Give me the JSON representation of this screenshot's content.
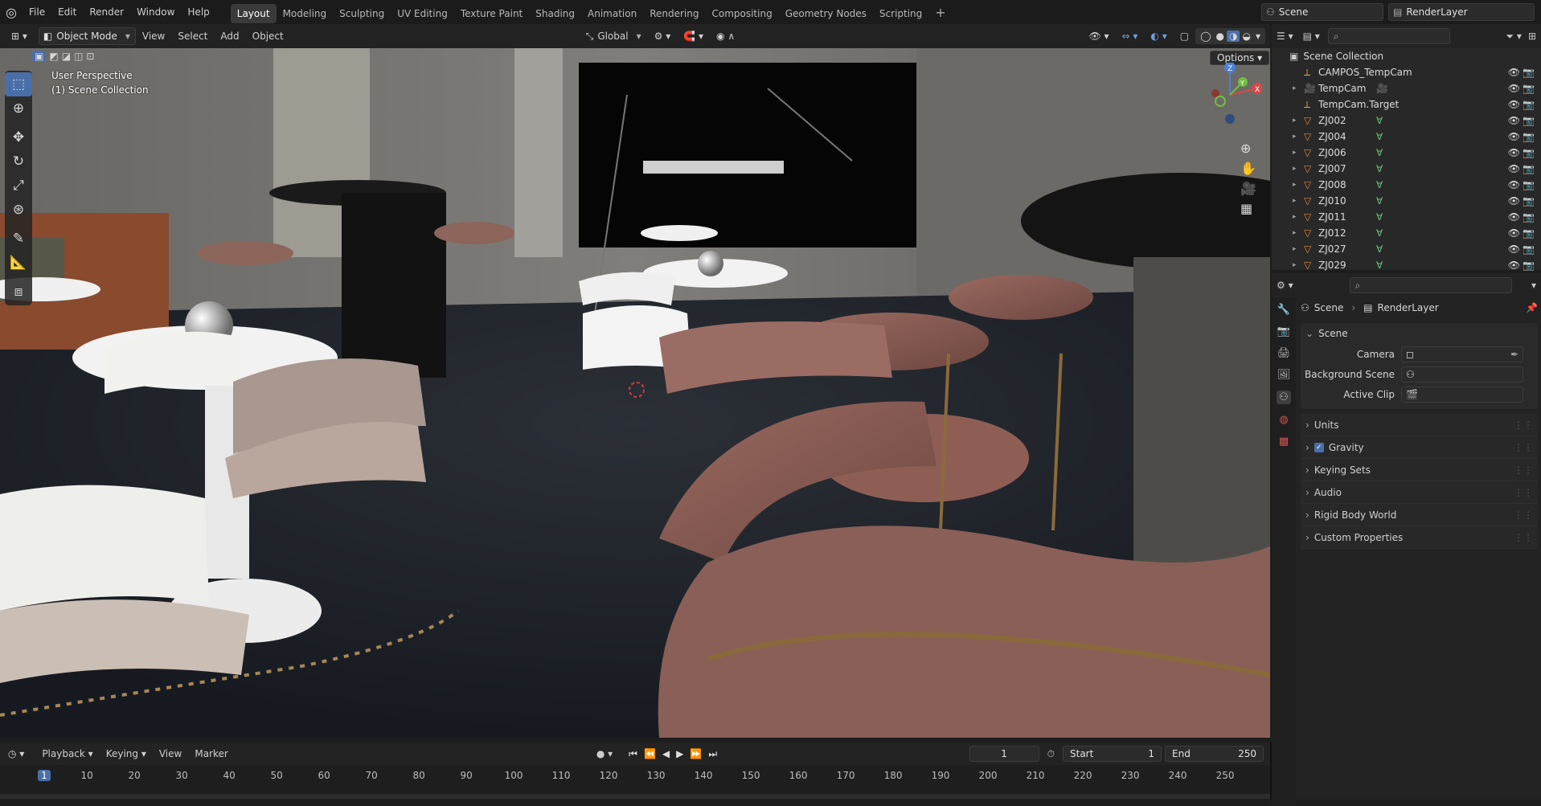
{
  "menu": [
    "File",
    "Edit",
    "Render",
    "Window",
    "Help"
  ],
  "workspaces": [
    "Layout",
    "Modeling",
    "Sculpting",
    "UV Editing",
    "Texture Paint",
    "Shading",
    "Animation",
    "Rendering",
    "Compositing",
    "Geometry Nodes",
    "Scripting"
  ],
  "top_right": {
    "scene": "Scene",
    "render_layer": "RenderLayer"
  },
  "header": {
    "mode": "Object Mode",
    "view": "View",
    "select": "Select",
    "add": "Add",
    "object": "Object",
    "orientation": "Global",
    "options": "Options"
  },
  "viewport": {
    "title": "User Perspective",
    "collection": "(1) Scene Collection"
  },
  "outliner": {
    "root": "Scene Collection",
    "items": [
      {
        "name": "CAMPOS_TempCam",
        "type": "empty"
      },
      {
        "name": "TempCam",
        "type": "camera"
      },
      {
        "name": "TempCam.Target",
        "type": "empty"
      },
      {
        "name": "ZJ002",
        "type": "mesh"
      },
      {
        "name": "ZJ004",
        "type": "mesh"
      },
      {
        "name": "ZJ006",
        "type": "mesh"
      },
      {
        "name": "ZJ007",
        "type": "mesh"
      },
      {
        "name": "ZJ008",
        "type": "mesh"
      },
      {
        "name": "ZJ010",
        "type": "mesh"
      },
      {
        "name": "ZJ011",
        "type": "mesh"
      },
      {
        "name": "ZJ012",
        "type": "mesh"
      },
      {
        "name": "ZJ027",
        "type": "mesh"
      },
      {
        "name": "ZJ029",
        "type": "mesh"
      }
    ]
  },
  "properties": {
    "breadcrumb_scene": "Scene",
    "breadcrumb_layer": "RenderLayer",
    "panel_title": "Scene",
    "camera_label": "Camera",
    "background_label": "Background Scene",
    "clip_label": "Active Clip",
    "sections": [
      "Units",
      "Gravity",
      "Keying Sets",
      "Audio",
      "Rigid Body World",
      "Custom Properties"
    ]
  },
  "timeline": {
    "playback": "Playback",
    "keying": "Keying",
    "view": "View",
    "marker": "Marker",
    "current_frame": "1",
    "start_label": "Start",
    "start": "1",
    "end_label": "End",
    "end": "250",
    "ruler": [
      "1",
      "10",
      "20",
      "30",
      "40",
      "50",
      "60",
      "70",
      "80",
      "90",
      "100",
      "110",
      "120",
      "130",
      "140",
      "150",
      "160",
      "170",
      "180",
      "190",
      "200",
      "210",
      "220",
      "230",
      "240",
      "250"
    ]
  },
  "colors": {
    "accent": "#4a6fa8",
    "mesh_icon": "#e8872e",
    "camera_green": "#5fc48b",
    "active_tab": "#3a3a3a"
  }
}
